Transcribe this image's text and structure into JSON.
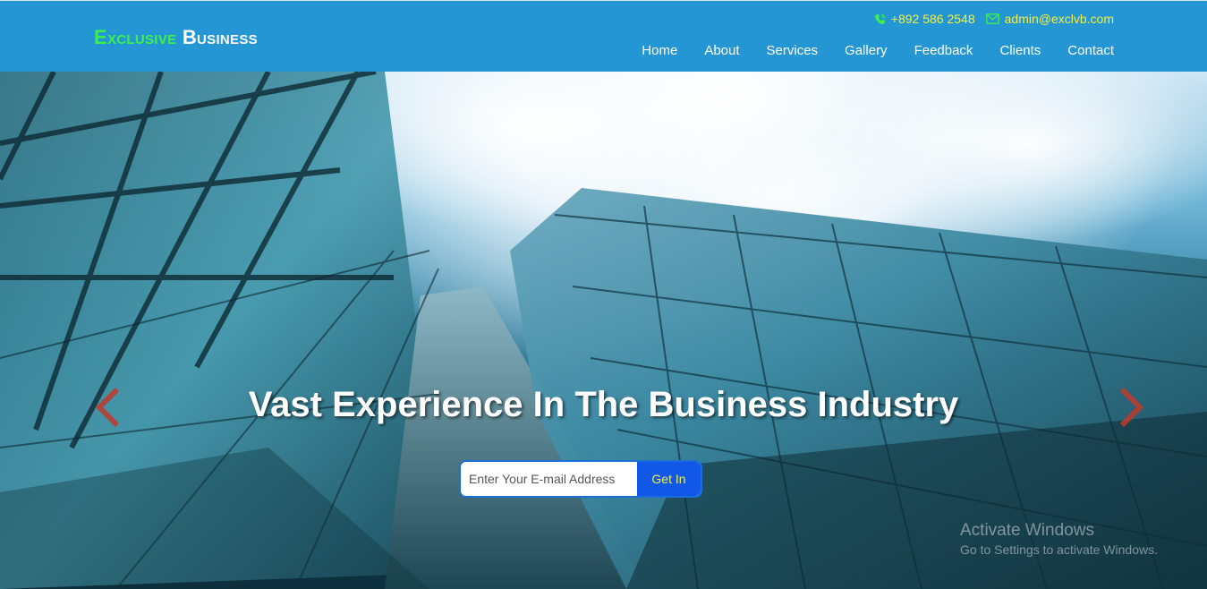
{
  "brand": {
    "word1": "Exclusive",
    "word2": "Business"
  },
  "contact": {
    "phone": "+892 586 2548",
    "email": "admin@exclvb.com"
  },
  "nav": [
    "Home",
    "About",
    "Services",
    "Gallery",
    "Feedback",
    "Clients",
    "Contact"
  ],
  "hero": {
    "title": "Vast Experience In The Business Industry",
    "email_placeholder": "Enter Your E-mail Address",
    "button_label": "Get In"
  },
  "watermark": {
    "line1": "Activate Windows",
    "line2": "Go to Settings to activate Windows."
  },
  "colors": {
    "header_bg": "#2596d4",
    "brand_accent": "#3cf04a",
    "contact_text": "#f4ef46",
    "button_bg": "#1258e8",
    "arrow": "#c0392b"
  },
  "icons": [
    "phone-icon",
    "envelope-icon",
    "chevron-left-icon",
    "chevron-right-icon"
  ]
}
